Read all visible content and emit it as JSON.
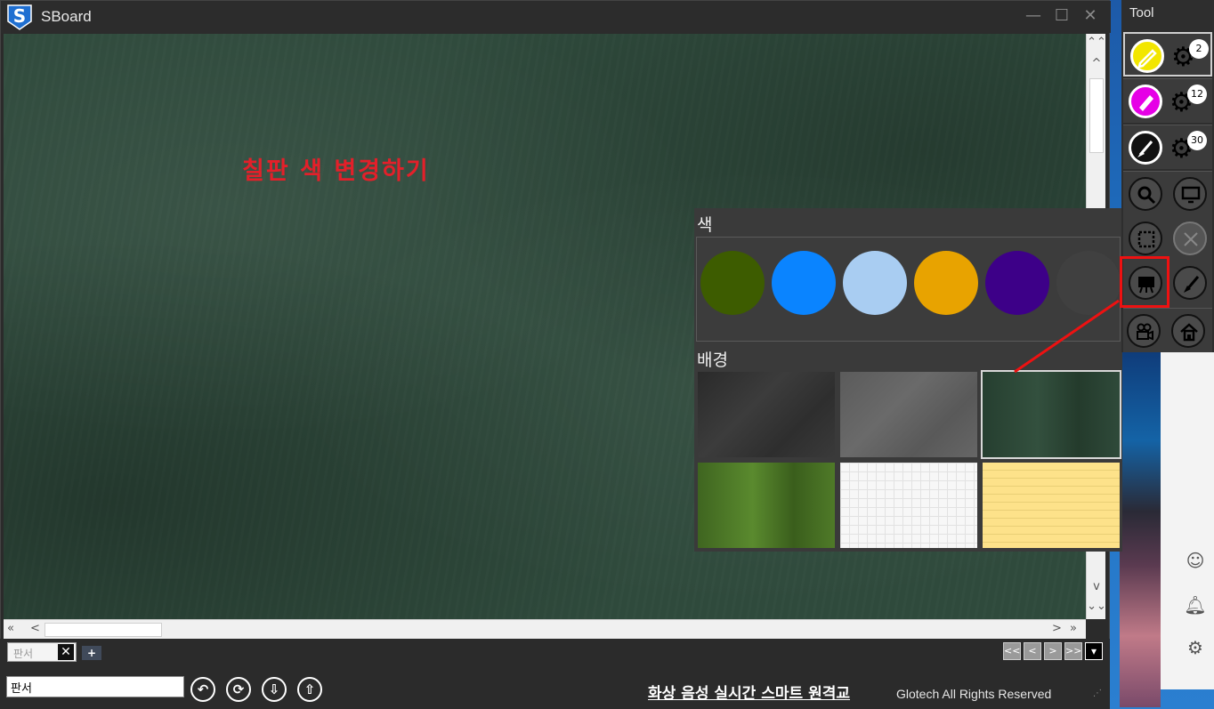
{
  "window": {
    "title": "SBoard",
    "controls": {
      "minimize": "—",
      "maximize": "☐",
      "close": "✕"
    }
  },
  "board": {
    "text": "칠판 색 변경하기",
    "text_color": "#e3202a",
    "background_color": "#2f4a3c"
  },
  "popup": {
    "color_label": "색",
    "background_label": "배경",
    "colors": [
      "#3d5c00",
      "#0a84ff",
      "#a9cdf2",
      "#e8a300",
      "#3d0088",
      "#404040"
    ],
    "backgrounds": [
      "dark-chalkboard",
      "gray-chalkboard",
      "green-chalkboard",
      "green-texture",
      "grid-paper",
      "yellow-lined-paper"
    ],
    "selected_background": "green-chalkboard"
  },
  "tabs": {
    "items": [
      {
        "label": "판서",
        "close": "✕"
      }
    ],
    "add_label": "+"
  },
  "pager": {
    "first": "<<",
    "prev": "<",
    "next": ">",
    "last": ">>",
    "menu": "▾"
  },
  "bottom": {
    "name_value": "판서",
    "marquee": "화상 음성 실시간 스마트 원격교",
    "copyright": "Glotech All Rights Reserved"
  },
  "tool": {
    "title": "Tool",
    "pens": [
      {
        "color": "#f2e600",
        "size": "2"
      },
      {
        "color": "#e600e6",
        "size": "12"
      },
      {
        "color": "#111111",
        "size": "30"
      }
    ],
    "icons": [
      "zoom-icon",
      "monitor-icon",
      "select-icon",
      "close-icon",
      "board-icon",
      "eraser-icon",
      "camera-icon",
      "home-icon"
    ],
    "selected_icon": "board-icon"
  },
  "scroll": {
    "up_fast": "⌃⌃",
    "up": "^",
    "down": "v",
    "down_fast": "⌄⌄",
    "left_fast": "«",
    "left": "<",
    "right": ">",
    "right_fast": "»"
  }
}
